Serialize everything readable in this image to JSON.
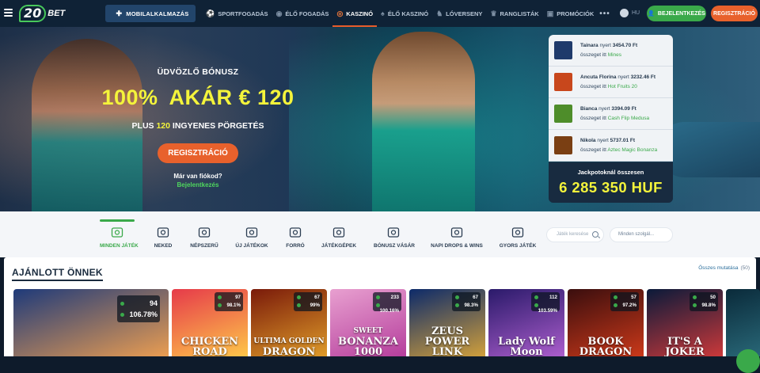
{
  "brand": {
    "number": "20",
    "suffix": "BET"
  },
  "topbar": {
    "mobile_app": "MOBILALKALMAZÁS",
    "nav": [
      {
        "label": "SPORTFOGADÁS",
        "icon": "soccer-ball-icon",
        "active": false
      },
      {
        "label": "ÉLŐ FOGADÁS",
        "icon": "live-icon",
        "active": false
      },
      {
        "label": "KASZINÓ",
        "icon": "casino-chip-icon",
        "active": true
      },
      {
        "label": "ÉLŐ KASZINÓ",
        "icon": "live-casino-icon",
        "active": false
      },
      {
        "label": "LÓVERSENY",
        "icon": "horse-icon",
        "active": false
      },
      {
        "label": "RANGLISTÁK",
        "icon": "trophy-icon",
        "active": false
      },
      {
        "label": "PROMÓCIÓK",
        "icon": "gift-icon",
        "active": false
      }
    ],
    "more": "•••",
    "language": "HU",
    "login": "BEJELENTKEZÉS",
    "register": "REGISZTRÁCIÓ"
  },
  "hero": {
    "welcome": "ÜDVÖZLŐ BÓNUSZ",
    "percent": "100%",
    "upto": "AKÁR € 120",
    "spins_prefix": "PLUS",
    "spins_count": "120",
    "spins_suffix": "INGYENES PÖRGETÉS",
    "cta": "REGISZTRÁCIÓ",
    "have_account": "Már van fiókod?",
    "login_link": "Bejelentkezés"
  },
  "winners": {
    "items": [
      {
        "name": "Tainara",
        "won": "nyert",
        "amount": "3454.70 Ft",
        "in_text": "összeget itt",
        "game": "Mines",
        "thumb_color": "#1f3a6b"
      },
      {
        "name": "Ancuta Florina",
        "won": "nyert",
        "amount": "3232.46 Ft",
        "in_text": "összeget itt",
        "game": "Hot Fruits 20",
        "thumb_color": "#c8471c"
      },
      {
        "name": "Bianca",
        "won": "nyert",
        "amount": "3394.09 Ft",
        "in_text": "összeget itt",
        "game": "Cash Flip Medusa",
        "thumb_color": "#4e8d2a"
      },
      {
        "name": "Nikola",
        "won": "nyert",
        "amount": "5737.01 Ft",
        "in_text": "összeget itt",
        "game": "Aztec Magic Bonanza",
        "thumb_color": "#7a3f13"
      }
    ],
    "jackpot_title": "Jackpotoknál összesen",
    "jackpot_value": "6 285 350 HUF"
  },
  "categories": [
    {
      "label": "MINDEN JÁTÉK",
      "icon": "all-games-icon",
      "active": true
    },
    {
      "label": "NEKED",
      "icon": "for-you-icon",
      "active": false
    },
    {
      "label": "NÉPSZERŰ",
      "icon": "crown-icon",
      "active": false
    },
    {
      "label": "ÚJ JÁTÉKOK",
      "icon": "star-icon",
      "active": false
    },
    {
      "label": "FORRÓ",
      "icon": "flame-icon",
      "active": false
    },
    {
      "label": "JÁTÉKGÉPEK",
      "icon": "slot-machine-icon",
      "active": false
    },
    {
      "label": "BÓNUSZ VÁSÁR",
      "icon": "bonus-bag-icon",
      "active": false
    },
    {
      "label": "NAPI DROPS & WINS",
      "icon": "drops-icon",
      "active": false
    },
    {
      "label": "GYORS JÁTÉK",
      "icon": "lightning-icon",
      "active": false
    }
  ],
  "search": {
    "placeholder": "Játék keresése"
  },
  "provider": {
    "placeholder": "Minden szolgál..."
  },
  "featured": {
    "title": "AJÁNLOTT ÖNNEK",
    "show_all": "Összes mutatása",
    "count": "(50)",
    "games": [
      {
        "title_top": "",
        "title_main": "",
        "players": "94",
        "rtp": "106.78%",
        "colors": [
          "#1e3a7a",
          "#f0a050"
        ]
      },
      {
        "title_top": "",
        "title_main": "CHICKEN ROAD",
        "players": "97",
        "rtp": "98.1%",
        "colors": [
          "#e63a4a",
          "#ffcc4a"
        ]
      },
      {
        "title_top": "ULTIMA GOLDEN",
        "title_main": "DRAGON",
        "players": "67",
        "rtp": "99%",
        "colors": [
          "#7a1a0a",
          "#e2a02a"
        ]
      },
      {
        "title_top": "SWEET",
        "title_main": "BONANZA 1000",
        "players": "233",
        "rtp": "100.16%",
        "colors": [
          "#e8a0d0",
          "#b33a9a"
        ]
      },
      {
        "title_top": "",
        "title_main": "ZEUS POWER LINK",
        "players": "67",
        "rtp": "98.3%",
        "colors": [
          "#0c2a6a",
          "#d8a43a"
        ]
      },
      {
        "title_top": "",
        "title_main": "Lady Wolf Moon",
        "players": "112",
        "rtp": "103.59%",
        "colors": [
          "#2a1a6a",
          "#b060d0"
        ]
      },
      {
        "title_top": "",
        "title_main": "BOOK DRAGON",
        "players": "57",
        "rtp": "97.2%",
        "colors": [
          "#3a0e0e",
          "#d03a1a"
        ]
      },
      {
        "title_top": "",
        "title_main": "IT'S A JOKER",
        "players": "50",
        "rtp": "98.8%",
        "colors": [
          "#0a1a3a",
          "#d23a3a"
        ]
      }
    ]
  },
  "colors": {
    "green": "#3aa94a",
    "orange": "#e8612c",
    "yellow": "#f4f43b",
    "nav_bg": "#0f2236"
  }
}
